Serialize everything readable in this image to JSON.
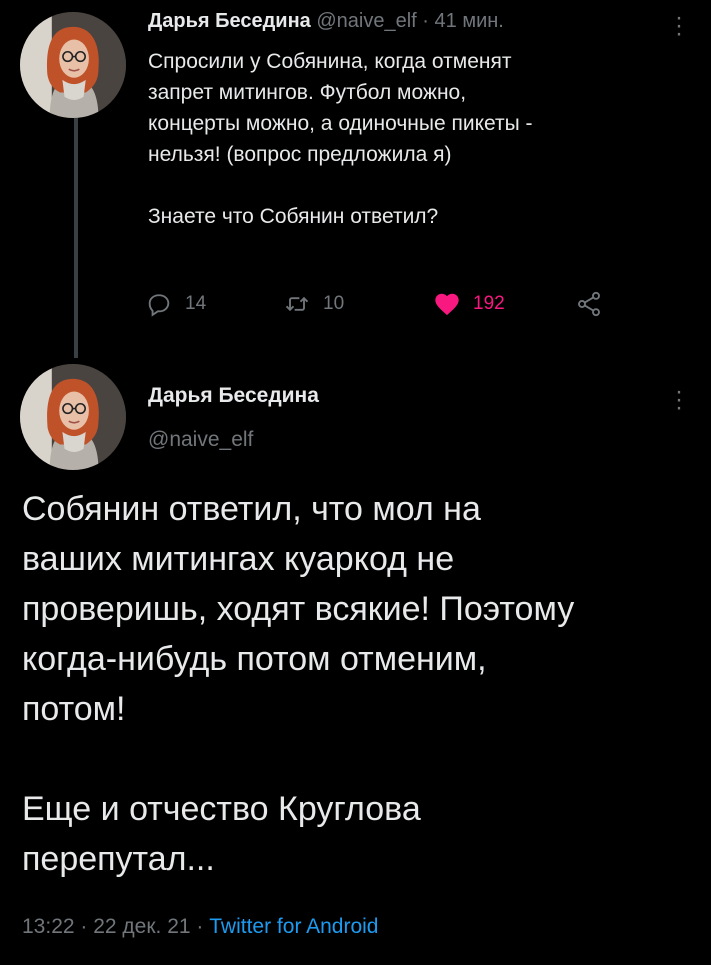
{
  "tweet1": {
    "author_name": "Дарья Беседина",
    "handle": "@naive_elf",
    "separator": " · ",
    "time_ago": "41 мин.",
    "text": [
      "Спросили у Собянина, когда отменят\nзапрет митингов. Футбол можно,\nконцерты можно, а одиночные пикеты -\nнельзя! (вопрос предложила я)",
      "Знаете что Собянин ответил?"
    ],
    "actions": {
      "replies": "14",
      "retweets": "10",
      "likes": "192"
    }
  },
  "tweet2": {
    "author_name": "Дарья Беседина",
    "handle": "@naive_elf",
    "text": [
      "Собянин ответил, что мол на\nваших митингах куаркод не\nпроверишь, ходят всякие! Поэтому\nкогда-нибудь потом отменим,\nпотом!",
      "Еще и отчество Круглова\nперепутал..."
    ],
    "footer": {
      "time": "13:22",
      "sep1": " · ",
      "date": "22 дек. 21",
      "sep2": " · ",
      "source": "Twitter for Android"
    }
  },
  "colors": {
    "background": "#000000",
    "text": "#e7e9ea",
    "muted": "#71767b",
    "like": "#f91880",
    "link": "#1d9bf0"
  },
  "icons": [
    "reply-icon",
    "retweet-icon",
    "like-icon",
    "share-icon",
    "more-icon"
  ]
}
